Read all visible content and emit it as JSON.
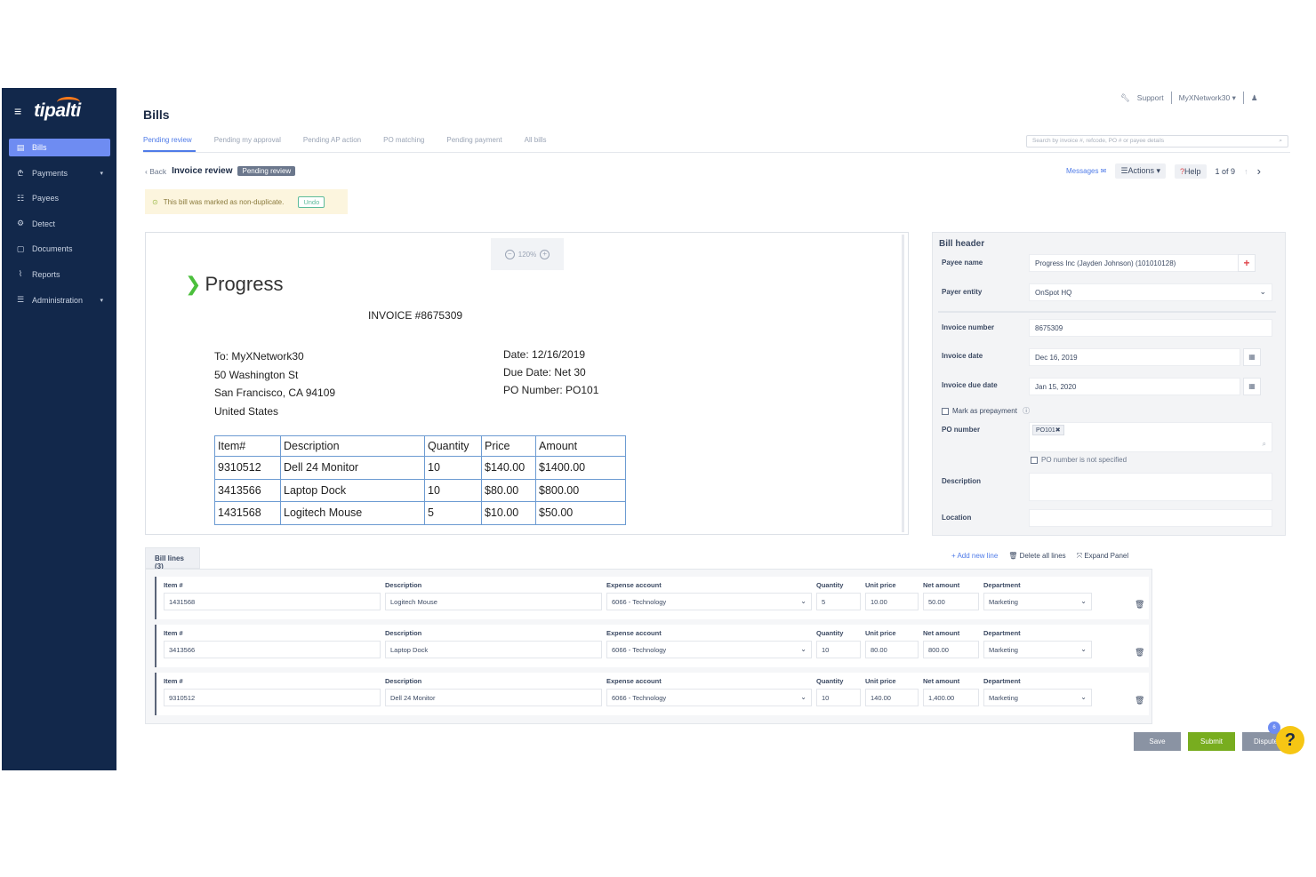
{
  "brand": {
    "logo_text": "tipalti"
  },
  "sidebar": {
    "items": [
      {
        "label": "Bills",
        "icon": "▤",
        "active": true
      },
      {
        "label": "Payments",
        "icon": "₾",
        "caret": "▾"
      },
      {
        "label": "Payees",
        "icon": "☷"
      },
      {
        "label": "Detect",
        "icon": "⚙"
      },
      {
        "label": "Documents",
        "icon": "▢"
      },
      {
        "label": "Reports",
        "icon": "⌇"
      },
      {
        "label": "Administration",
        "icon": "☰",
        "caret": "▾"
      }
    ]
  },
  "topbar": {
    "support": "Support",
    "account": "MyXNetwork30 ▾",
    "user_icon": "♟"
  },
  "page": {
    "title": "Bills"
  },
  "tabs": [
    "Pending review",
    "Pending my approval",
    "Pending AP action",
    "PO matching",
    "Pending payment",
    "All bills"
  ],
  "search": {
    "placeholder": "Search by invoice #, refcode, PO # or payee details"
  },
  "subhead": {
    "back": "Back",
    "title": "Invoice review",
    "status": "Pending review"
  },
  "actions": {
    "messages": "Messages ✉",
    "actions": "☰Actions ▾",
    "help": "Help",
    "pager": "1 of 9",
    "next": "›",
    "up": "↑"
  },
  "notice": {
    "text": "This bill was marked as non-duplicate.",
    "undo": "Undo"
  },
  "doc": {
    "zoom": "120%",
    "brand_name": "Progress",
    "invoice_no": "INVOICE #8675309",
    "address": [
      "To: MyXNetwork30",
      "50 Washington St",
      "San Francisco, CA 94109",
      "United States"
    ],
    "meta": [
      "Date: 12/16/2019",
      "Due Date: Net 30",
      "PO Number: PO101"
    ],
    "table_headers": [
      "Item#",
      "Description",
      "Quantity",
      "Price",
      "Amount"
    ],
    "table_rows": [
      [
        "9310512",
        "Dell 24 Monitor",
        "10",
        "$140.00",
        "$1400.00"
      ],
      [
        "3413566",
        "Laptop Dock",
        "10",
        "$80.00",
        "$800.00"
      ],
      [
        "1431568",
        "Logitech Mouse",
        "5",
        "$10.00",
        "$50.00"
      ]
    ]
  },
  "bill_header": {
    "title": "Bill header",
    "payee_name_label": "Payee name",
    "payee_name": "Progress Inc (Jayden Johnson) (101010128)",
    "payer_entity_label": "Payer entity",
    "payer_entity": "OnSpot HQ",
    "invoice_number_label": "Invoice number",
    "invoice_number": "8675309",
    "invoice_date_label": "Invoice date",
    "invoice_date": "Dec 16, 2019",
    "due_date_label": "Invoice due date",
    "due_date": "Jan 15, 2020",
    "prepayment_label": "Mark as prepayment",
    "po_label": "PO number",
    "po_value": "PO101✖",
    "po_not_specified": "PO number is not specified",
    "description_label": "Description",
    "location_label": "Location"
  },
  "bill_lines": {
    "tab": "Bill lines (3)",
    "add": "+ Add new line",
    "delete_all": "Delete all lines",
    "expand": "Expand Panel",
    "labels": {
      "item": "Item #",
      "description": "Description",
      "expense": "Expense account",
      "quantity": "Quantity",
      "unit_price": "Unit price",
      "net": "Net amount",
      "department": "Department"
    },
    "lines": [
      {
        "item": "1431568",
        "description": "Logitech Mouse",
        "expense": "6066 - Technology",
        "quantity": "5",
        "unit_price": "10.00",
        "net": "50.00",
        "department": "Marketing"
      },
      {
        "item": "3413566",
        "description": "Laptop Dock",
        "expense": "6066 - Technology",
        "quantity": "10",
        "unit_price": "80.00",
        "net": "800.00",
        "department": "Marketing"
      },
      {
        "item": "9310512",
        "description": "Dell 24 Monitor",
        "expense": "6066 - Technology",
        "quantity": "10",
        "unit_price": "140.00",
        "net": "1,400.00",
        "department": "Marketing"
      }
    ]
  },
  "buttons": {
    "save": "Save",
    "submit": "Submit",
    "dispute": "Dispute"
  },
  "help_fab": {
    "icon": "?",
    "badge": "6"
  }
}
